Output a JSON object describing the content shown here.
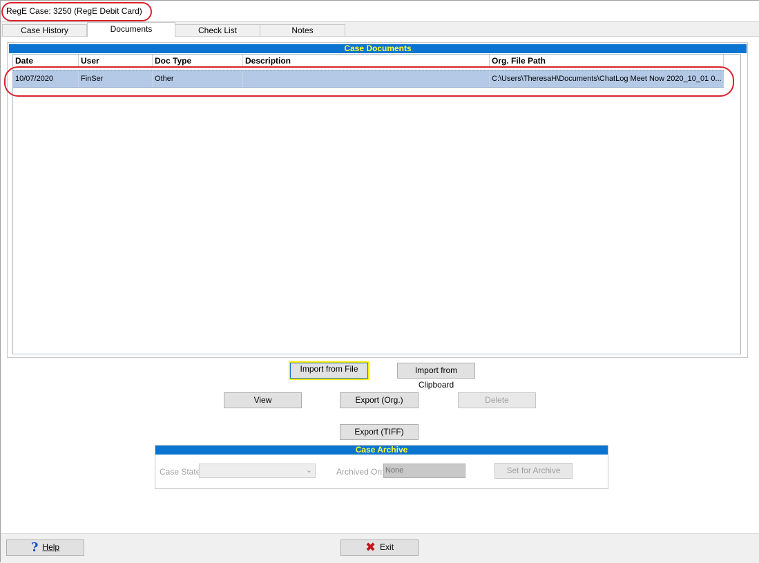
{
  "case_title": "RegE Case: 3250 (RegE Debit Card)",
  "tabs": [
    {
      "label": "Case History",
      "active": false
    },
    {
      "label": "Documents",
      "active": true
    },
    {
      "label": "Check List",
      "active": false
    },
    {
      "label": "Notes",
      "active": false
    }
  ],
  "case_documents": {
    "header": "Case Documents",
    "columns": [
      "Date",
      "User",
      "Doc Type",
      "Description",
      "Org. File Path"
    ],
    "rows": [
      {
        "date": "10/07/2020",
        "user": "FinSer",
        "doc_type": "Other",
        "description": "",
        "file_path": "C:\\Users\\TheresaH\\Documents\\ChatLog Meet Now 2020_10_01 0..."
      }
    ]
  },
  "buttons": {
    "import_file": "Import from File",
    "import_clipboard": "Import from Clipboard",
    "view": "View",
    "export_org": "Export (Org.)",
    "delete": "Delete",
    "export_tiff": "Export (TIFF)"
  },
  "case_archive": {
    "header": "Case Archive",
    "case_state_label": "Case State",
    "case_state_value": "",
    "archived_on_label": "Archived On:",
    "archived_on_value": "None",
    "set_for_archive": "Set for Archive"
  },
  "footer": {
    "help": "Help",
    "exit": "Exit"
  },
  "colors": {
    "header_bg": "#0b74d1",
    "header_text": "#ffff33",
    "selected_row": "#b4c9e6",
    "annotation_red": "#d6232c",
    "focus_yellow": "#ffee00"
  },
  "icons": {
    "help": "question-mark-icon",
    "exit": "red-x-icon",
    "dropdown": "chevron-down-icon"
  }
}
